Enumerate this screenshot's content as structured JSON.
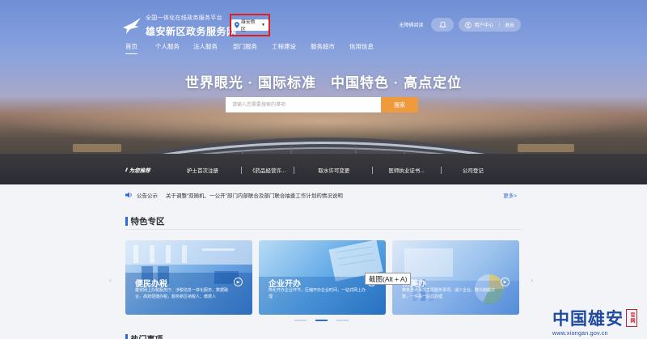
{
  "header": {
    "logo_subtitle": "全国一体化在线政务服务平台",
    "logo_title": "雄安新区政务服务网",
    "region": "雄安新区",
    "accessibility_link": "无障碍阅读",
    "user_center": "用户中心",
    "logout": "退出",
    "nav": [
      "首页",
      "个人服务",
      "法人服务",
      "部门服务",
      "工程建设",
      "服务超市",
      "信用信息"
    ]
  },
  "hero": {
    "slogan": "世界眼光 · 国际标准　中国特色 · 高点定位",
    "search_placeholder": "请输入您需要搜索的事项",
    "search_button": "搜索"
  },
  "recommend": {
    "title": "为您推荐",
    "items": [
      "护士首次注册",
      "《药品经营许...",
      "取水许可变更",
      "医师执业证书...",
      "公司登记"
    ]
  },
  "notice": {
    "label": "公告公示",
    "text": "关于调整“双随机、一公开”部门内部联合及部门联合抽查工作计划的情况说明",
    "more": "更多>"
  },
  "feature": {
    "title": "特色专区",
    "cards": [
      {
        "title": "便民办税",
        "desc": "雄安网上办税服务厅、涉税信息一体化服务，数据融合，高效便捷办税，服务新区纳税人、缴费人"
      },
      {
        "title": "企业开办",
        "desc": "简化开办企业环节，压缩开办企业时间，一站式网上办理"
      },
      {
        "title": "…美办",
        "desc": "聚焦重点事项主题服务事项，减少企业、群众跑腿次数，一件事一站式办理"
      }
    ],
    "carousel_pages": 3,
    "carousel_active": 1
  },
  "tooltip": "截图(Alt + A)",
  "next_section_title": "热门事项",
  "watermark": {
    "brand": "中国雄安",
    "seal": "官网",
    "url": "www.xiongan.gov.cn"
  },
  "colors": {
    "accent": "#2f6bd6",
    "search_button": "#f09a3e",
    "highlight_box": "#e02020",
    "brand_blue": "#1f4aa0",
    "seal_red": "#c8202a"
  }
}
